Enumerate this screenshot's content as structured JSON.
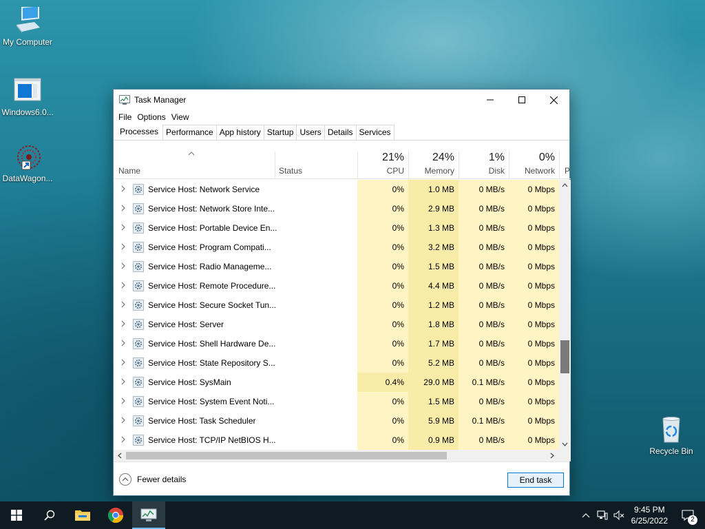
{
  "desktop": {
    "icons": [
      {
        "label": "My Computer"
      },
      {
        "label": "Windows6.0..."
      },
      {
        "label": "DataWagon..."
      },
      {
        "label": "Recycle Bin"
      }
    ]
  },
  "window": {
    "title": "Task Manager",
    "menu": [
      "File",
      "Options",
      "View"
    ],
    "tabs": [
      "Processes",
      "Performance",
      "App history",
      "Startup",
      "Users",
      "Details",
      "Services"
    ],
    "active_tab": "Processes"
  },
  "header": {
    "name": "Name",
    "status": "Status",
    "cpu_pct": "21%",
    "cpu": "CPU",
    "mem_pct": "24%",
    "mem": "Memory",
    "disk_pct": "1%",
    "disk": "Disk",
    "net_pct": "0%",
    "net": "Network",
    "more": "P"
  },
  "rows": [
    {
      "name": "Service Host: Network Service",
      "cpu": "0%",
      "mem": "1.0 MB",
      "disk": "0 MB/s",
      "net": "0 Mbps"
    },
    {
      "name": "Service Host: Network Store Inte...",
      "cpu": "0%",
      "mem": "2.9 MB",
      "disk": "0 MB/s",
      "net": "0 Mbps"
    },
    {
      "name": "Service Host: Portable Device En...",
      "cpu": "0%",
      "mem": "1.3 MB",
      "disk": "0 MB/s",
      "net": "0 Mbps"
    },
    {
      "name": "Service Host: Program Compati...",
      "cpu": "0%",
      "mem": "3.2 MB",
      "disk": "0 MB/s",
      "net": "0 Mbps"
    },
    {
      "name": "Service Host: Radio Manageme...",
      "cpu": "0%",
      "mem": "1.5 MB",
      "disk": "0 MB/s",
      "net": "0 Mbps"
    },
    {
      "name": "Service Host: Remote Procedure...",
      "cpu": "0%",
      "mem": "4.4 MB",
      "disk": "0 MB/s",
      "net": "0 Mbps"
    },
    {
      "name": "Service Host: Secure Socket Tun...",
      "cpu": "0%",
      "mem": "1.2 MB",
      "disk": "0 MB/s",
      "net": "0 Mbps"
    },
    {
      "name": "Service Host: Server",
      "cpu": "0%",
      "mem": "1.8 MB",
      "disk": "0 MB/s",
      "net": "0 Mbps"
    },
    {
      "name": "Service Host: Shell Hardware De...",
      "cpu": "0%",
      "mem": "1.7 MB",
      "disk": "0 MB/s",
      "net": "0 Mbps"
    },
    {
      "name": "Service Host: State Repository S...",
      "cpu": "0%",
      "mem": "5.2 MB",
      "disk": "0 MB/s",
      "net": "0 Mbps"
    },
    {
      "name": "Service Host: SysMain",
      "cpu": "0.4%",
      "mem": "29.0 MB",
      "disk": "0.1 MB/s",
      "net": "0 Mbps"
    },
    {
      "name": "Service Host: System Event Noti...",
      "cpu": "0%",
      "mem": "1.5 MB",
      "disk": "0 MB/s",
      "net": "0 Mbps"
    },
    {
      "name": "Service Host: Task Scheduler",
      "cpu": "0%",
      "mem": "5.9 MB",
      "disk": "0.1 MB/s",
      "net": "0 Mbps"
    },
    {
      "name": "Service Host: TCP/IP NetBIOS H...",
      "cpu": "0%",
      "mem": "0.9 MB",
      "disk": "0 MB/s",
      "net": "0 Mbps"
    }
  ],
  "footer": {
    "fewer_details": "Fewer details",
    "end_task": "End task"
  },
  "taskbar": {
    "time": "9:45 PM",
    "date": "6/25/2022",
    "notifications": "2"
  },
  "colors": {
    "heat_light": "#fff4c4",
    "heat_mid": "#f9eca8",
    "accent": "#0078d7"
  }
}
